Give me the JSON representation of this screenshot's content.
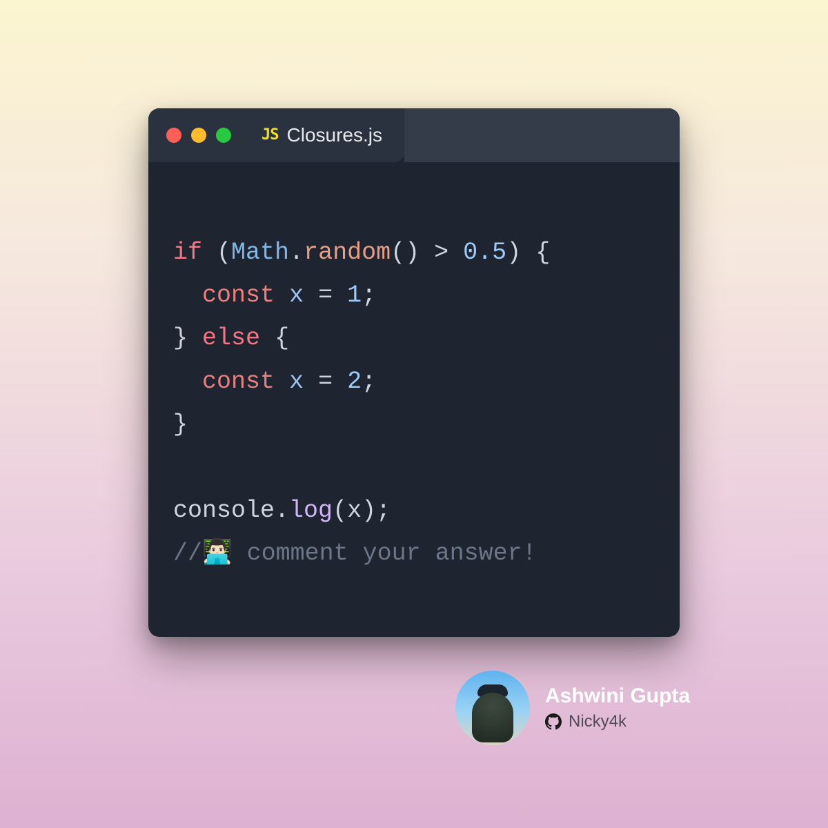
{
  "tab": {
    "icon_label": "JS",
    "title": "Closures.js"
  },
  "colors": {
    "traffic": {
      "red": "#ff5f56",
      "yellow": "#ffbd2e",
      "green": "#27c93f"
    }
  },
  "code": {
    "line1": {
      "if": "if",
      "sp1": " ",
      "lp": "(",
      "cls": "Math",
      "dot": ".",
      "meth": "random",
      "paren": "()",
      "sp2": " ",
      "gt": ">",
      "sp3": " ",
      "num": "0.5",
      "rp": ")",
      "sp4": " ",
      "lbrace": "{"
    },
    "line2": {
      "indent": "  ",
      "const": "const",
      "sp1": " ",
      "var": "x",
      "sp2": " ",
      "eq": "=",
      "sp3": " ",
      "num": "1",
      "semi": ";"
    },
    "line3": {
      "rbrace": "}",
      "sp1": " ",
      "else": "else",
      "sp2": " ",
      "lbrace": "{"
    },
    "line4": {
      "indent": "  ",
      "const": "const",
      "sp1": " ",
      "var": "x",
      "sp2": " ",
      "eq": "=",
      "sp3": " ",
      "num": "2",
      "semi": ";"
    },
    "line5": {
      "rbrace": "}"
    },
    "line6": {
      "blank": ""
    },
    "line7": {
      "console": "console",
      "dot": ".",
      "log": "log",
      "lp": "(",
      "var": "x",
      "rp": ")",
      "semi": ";"
    },
    "line8": {
      "comment": "//👨🏻‍💻 comment your answer!"
    }
  },
  "attribution": {
    "name": "Ashwini Gupta",
    "handle": "Nicky4k"
  }
}
